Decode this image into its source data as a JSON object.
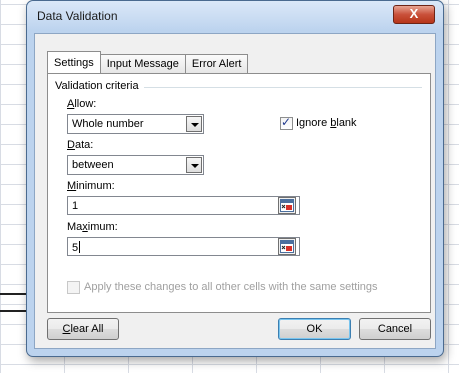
{
  "window": {
    "title": "Data Validation",
    "close_glyph": "X"
  },
  "tabs": [
    {
      "label": "Settings",
      "active": true
    },
    {
      "label": "Input Message",
      "active": false
    },
    {
      "label": "Error Alert",
      "active": false
    }
  ],
  "settings": {
    "group_label": "Validation criteria",
    "allow": {
      "label_pre": "",
      "label_key": "A",
      "label_post": "llow:",
      "value": "Whole number"
    },
    "ignore_blank": {
      "label_pre": "Ignore ",
      "label_key": "b",
      "label_post": "lank",
      "checked": true
    },
    "data": {
      "label_pre": "",
      "label_key": "D",
      "label_post": "ata:",
      "value": "between"
    },
    "minimum": {
      "label_pre": "",
      "label_key": "M",
      "label_post": "inimum:",
      "value": "1"
    },
    "maximum": {
      "label_pre": "Ma",
      "label_key": "x",
      "label_post": "imum:",
      "value": "5"
    },
    "apply_all": {
      "label": "Apply these changes to all other cells with the same settings",
      "checked": false,
      "enabled": false
    }
  },
  "buttons": {
    "clear_all": {
      "label_key": "C",
      "label_post": "lear All"
    },
    "ok": "OK",
    "cancel": "Cancel"
  },
  "icons": {
    "close": "close-icon",
    "range_ref": "collapse-dialog-icon",
    "dropdown": "chevron-down-icon",
    "check": "checkmark-icon"
  },
  "colors": {
    "window_frame": "#bcd3ee",
    "close_button": "#c9503a",
    "client_bg": "#f0f0f0",
    "panel_bg": "#ffffff"
  }
}
